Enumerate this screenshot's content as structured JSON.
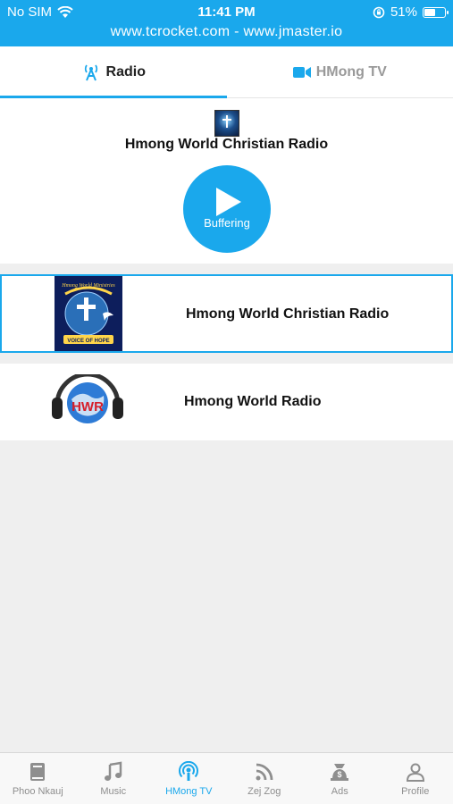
{
  "status": {
    "carrier": "No SIM",
    "time": "11:41 PM",
    "battery_percent": "51%",
    "battery_level": 0.51,
    "url_banner": "www.tcrocket.com - www.jmaster.io"
  },
  "tabs": [
    {
      "label": "Radio",
      "icon": "radio-tower-icon",
      "active": true
    },
    {
      "label": "HMong TV",
      "icon": "video-camera-icon",
      "active": false
    }
  ],
  "player": {
    "title": "Hmong World Christian Radio",
    "button_state": "Buffering"
  },
  "stations": [
    {
      "name": "Hmong World Christian Radio",
      "logo_text": "Hmong World Ministries",
      "logo_subtext": "VOICE OF HOPE",
      "selected": true
    },
    {
      "name": "Hmong World Radio",
      "logo_text": "HWR",
      "selected": false
    }
  ],
  "bottom_nav": [
    {
      "label": "Phoo Nkauj",
      "icon": "book-icon",
      "active": false
    },
    {
      "label": "Music",
      "icon": "music-note-icon",
      "active": false
    },
    {
      "label": "HMong TV",
      "icon": "podcast-icon",
      "active": true
    },
    {
      "label": "Zej Zog",
      "icon": "rss-icon",
      "active": false
    },
    {
      "label": "Ads",
      "icon": "money-bag-icon",
      "active": false
    },
    {
      "label": "Profile",
      "icon": "user-icon",
      "active": false
    }
  ],
  "colors": {
    "accent": "#1aa8ec",
    "inactive": "#8e8e8e"
  }
}
